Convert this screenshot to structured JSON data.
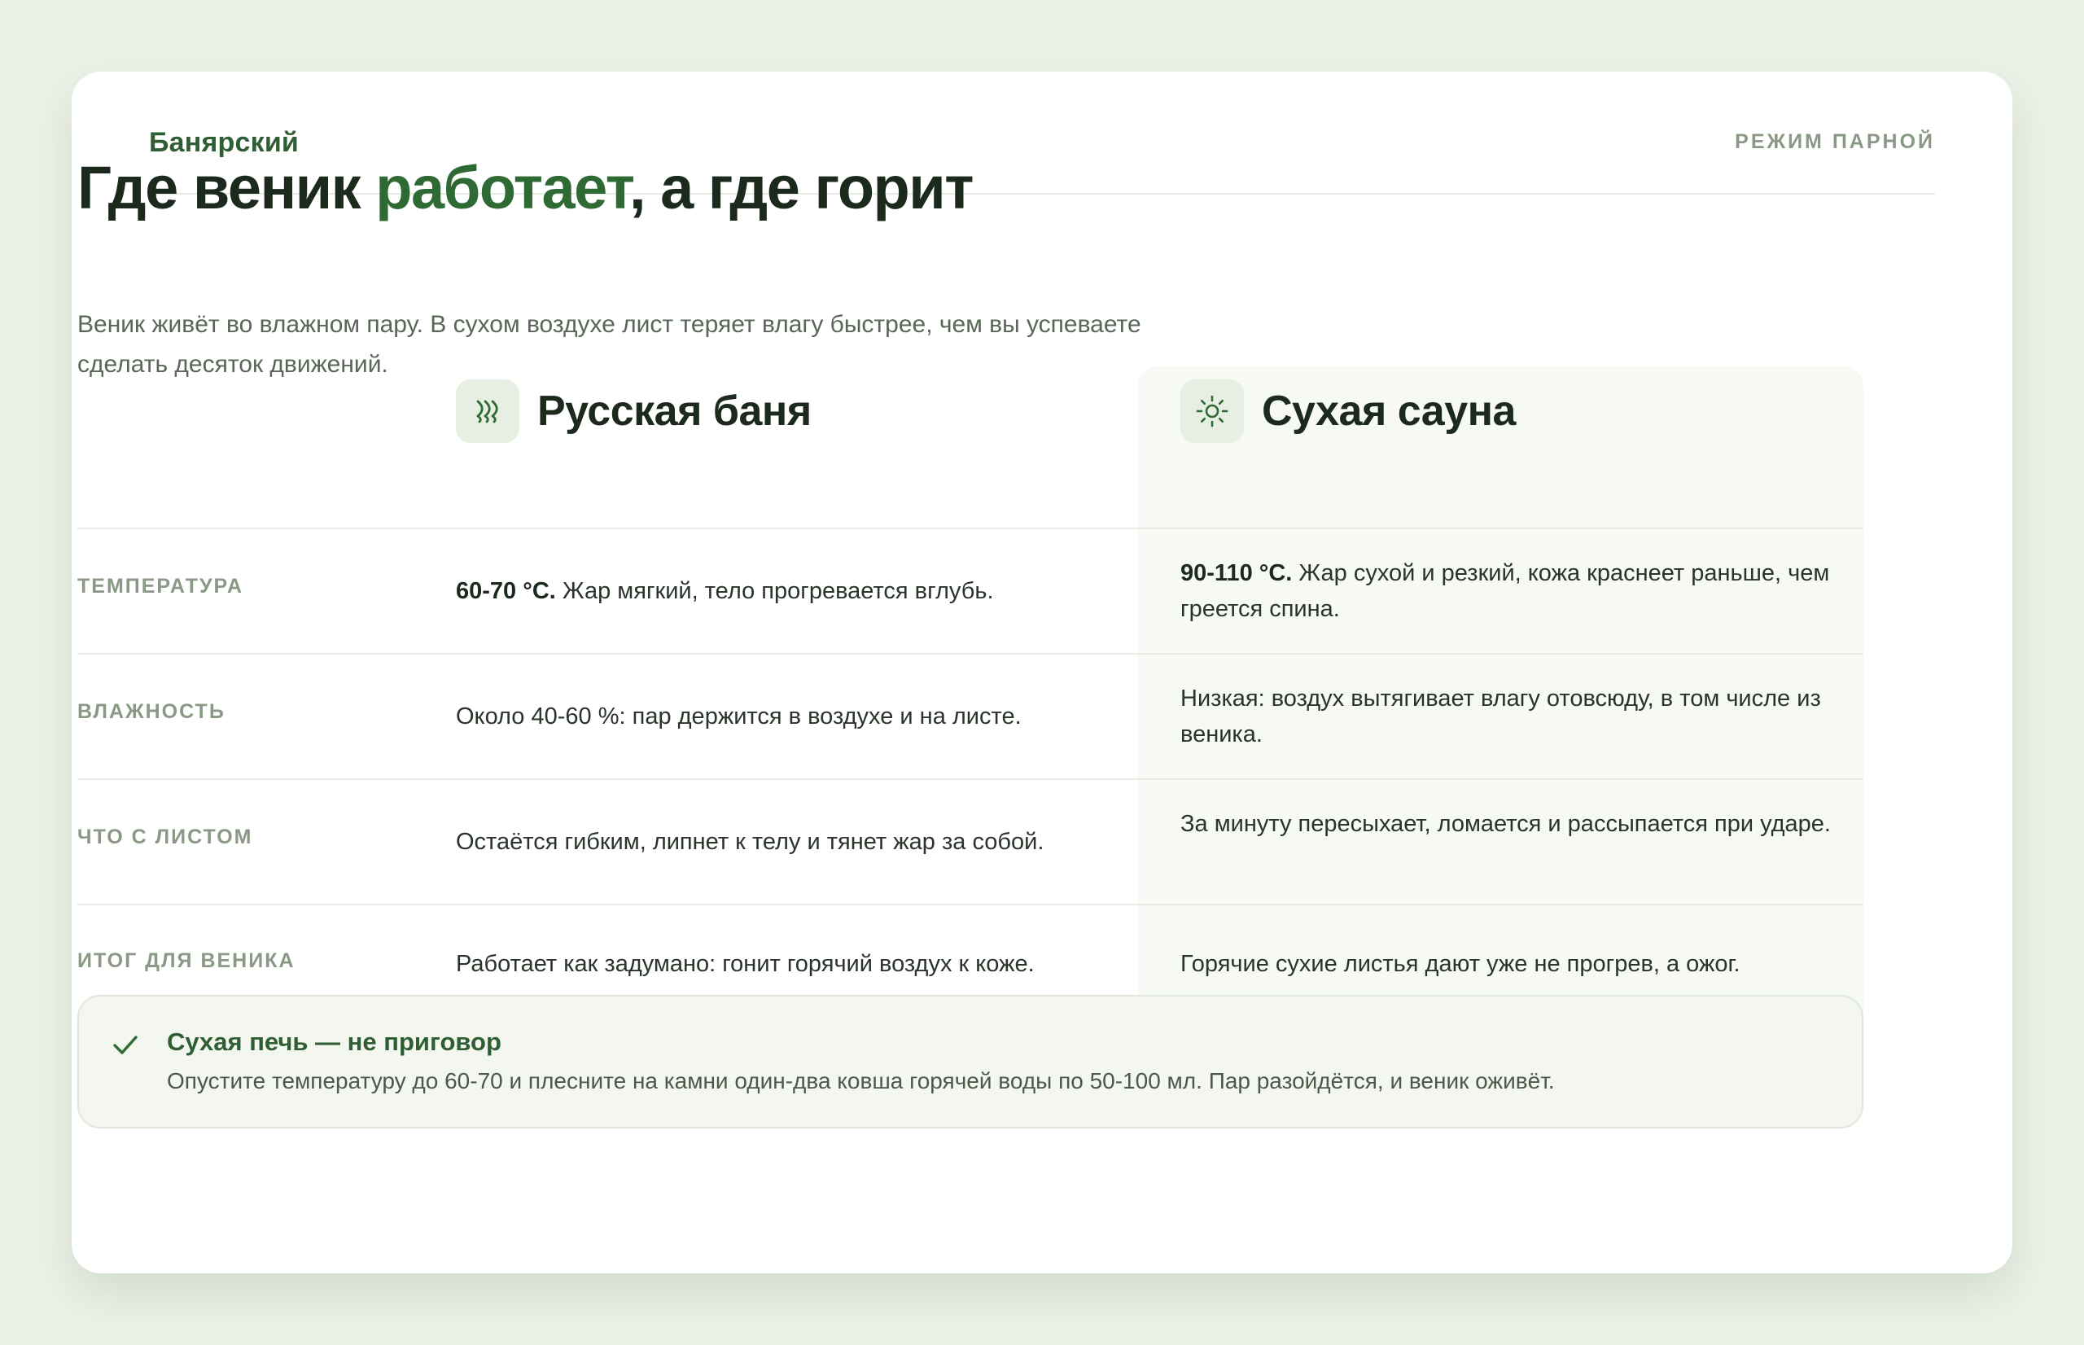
{
  "brand": "Банярский",
  "mode_label": "РЕЖИМ ПАРНОЙ",
  "headline": {
    "before": "Где веник ",
    "accent": "работает",
    "after": ", а где горит"
  },
  "lead": "Веник живёт во влажном пару. В сухом воздухе лист теряет влагу быстрее, чем вы успеваете сделать десяток движений.",
  "columns": {
    "bath": {
      "title": "Русская баня",
      "icon": "steam-icon"
    },
    "sauna": {
      "title": "Сухая сауна",
      "icon": "sun-icon"
    }
  },
  "rows": [
    {
      "label": "ТЕМПЕРАТУРА",
      "bath_strong": "60-70 °C.",
      "bath_text": " Жар мягкий, тело прогревается вглубь.",
      "sauna_strong": "90-110 °C.",
      "sauna_text": " Жар сухой и резкий, кожа краснеет раньше, чем греется спина."
    },
    {
      "label": "ВЛАЖНОСТЬ",
      "bath_text": "Около 40-60 %: пар держится в воздухе и на листе.",
      "sauna_text": "Низкая: воздух вытягивает влагу отовсюду, в том числе из веника."
    },
    {
      "label": "ЧТО С ЛИСТОМ",
      "bath_text": "Остаётся гибким, липнет к телу и тянет жар за собой.",
      "sauna_text": "За минуту пересыхает, ломается и рассыпается при ударе."
    },
    {
      "label": "ИТОГ ДЛЯ ВЕНИКА",
      "bath_text": "Работает как задумано: гонит горячий воздух к коже.",
      "sauna_text": "Горячие сухие листья дают уже не прогрев, а ожог."
    }
  ],
  "tip": {
    "icon": "check-icon",
    "title": "Сухая печь — не приговор",
    "text": "Опустите температуру до 60-70 и плесните на камни один-два ковша горячей воды по 50-100 мл. Пар разойдётся, и веник оживёт."
  },
  "colors": {
    "accent": "#2f6a35",
    "muted": "#8a9886",
    "page_bg": "#ecf2e8"
  }
}
